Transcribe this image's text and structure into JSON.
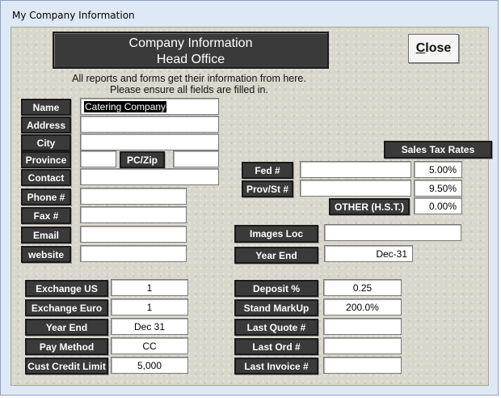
{
  "window": {
    "title": "My Company Information"
  },
  "header": {
    "line1": "Company Information",
    "line2": "Head Office"
  },
  "close_button": {
    "label_first": "C",
    "label_rest": "lose"
  },
  "info": {
    "line1": "All reports and forms get their information from here.",
    "line2": "Please ensure all fields are filled in."
  },
  "company": {
    "name_label": "Name",
    "name_value": "Catering Company",
    "address_label": "Address",
    "address_value": "",
    "city_label": "City",
    "city_value": "",
    "province_label": "Province",
    "province_value": "",
    "pczip_label": "PC/Zip",
    "pczip_value": "",
    "contact_label": "Contact",
    "contact_value": "",
    "phone_label": "Phone #",
    "phone_value": "",
    "fax_label": "Fax #",
    "fax_value": "",
    "email_label": "Email",
    "email_value": "",
    "website_label": "website",
    "website_value": ""
  },
  "tax": {
    "title": "Sales Tax Rates",
    "fed_label": "Fed #",
    "fed_value": "",
    "fed_rate": "5.00%",
    "prov_label": "Prov/St #",
    "prov_value": "",
    "prov_rate": "9.50%",
    "other_label": "OTHER (H.S.T.)",
    "other_rate": "0.00%"
  },
  "images": {
    "label": "Images Loc",
    "value": ""
  },
  "year_end_right": {
    "label": "Year End",
    "value": "Dec-31"
  },
  "left_settings": {
    "exchange_us_label": "Exchange US",
    "exchange_us_value": "1",
    "exchange_euro_label": "Exchange Euro",
    "exchange_euro_value": "1",
    "year_end_label": "Year End",
    "year_end_value": "Dec 31",
    "pay_method_label": "Pay Method",
    "pay_method_value": "CC",
    "credit_label": "Cust Credit Limit",
    "credit_value": "5,000"
  },
  "right_settings": {
    "deposit_label": "Deposit %",
    "deposit_value": "0.25",
    "markup_label": "Stand MarkUp",
    "markup_value": "200.0%",
    "last_quote_label": "Last Quote #",
    "last_quote_value": "",
    "last_ord_label": "Last Ord #",
    "last_ord_value": "",
    "last_invoice_label": "Last Invoice #",
    "last_invoice_value": ""
  }
}
